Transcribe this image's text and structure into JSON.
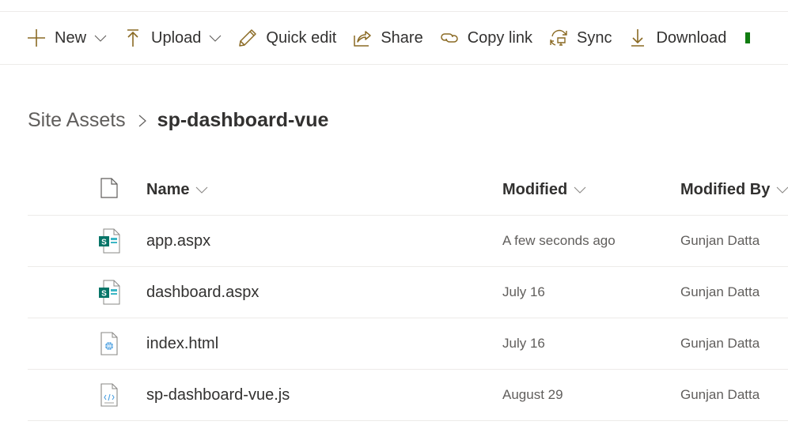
{
  "command_bar": {
    "items": [
      {
        "id": "new",
        "label": "New",
        "icon": "plus-icon",
        "has_dropdown": true
      },
      {
        "id": "upload",
        "label": "Upload",
        "icon": "upload-icon",
        "has_dropdown": true
      },
      {
        "id": "quick_edit",
        "label": "Quick edit",
        "icon": "pencil-icon",
        "has_dropdown": false
      },
      {
        "id": "share",
        "label": "Share",
        "icon": "share-icon",
        "has_dropdown": false
      },
      {
        "id": "copy_link",
        "label": "Copy link",
        "icon": "link-icon",
        "has_dropdown": false
      },
      {
        "id": "sync",
        "label": "Sync",
        "icon": "sync-icon",
        "has_dropdown": false
      },
      {
        "id": "download",
        "label": "Download",
        "icon": "download-icon",
        "has_dropdown": false
      }
    ],
    "icon_color": "#8a6a24"
  },
  "breadcrumb": {
    "parent": "Site Assets",
    "current": "sp-dashboard-vue"
  },
  "list": {
    "columns": [
      {
        "id": "type",
        "label": "",
        "icon": "file-type-icon"
      },
      {
        "id": "name",
        "label": "Name"
      },
      {
        "id": "modified",
        "label": "Modified"
      },
      {
        "id": "modified_by",
        "label": "Modified By"
      }
    ],
    "rows": [
      {
        "name": "app.aspx",
        "icon": "sharepoint-page-icon",
        "modified": "A few seconds ago",
        "modified_by": "Gunjan Datta"
      },
      {
        "name": "dashboard.aspx",
        "icon": "sharepoint-page-icon",
        "modified": "July 16",
        "modified_by": "Gunjan Datta"
      },
      {
        "name": "index.html",
        "icon": "html-file-icon",
        "modified": "July 16",
        "modified_by": "Gunjan Datta"
      },
      {
        "name": "sp-dashboard-vue.js",
        "icon": "code-file-icon",
        "modified": "August 29",
        "modified_by": "Gunjan Datta"
      }
    ]
  }
}
